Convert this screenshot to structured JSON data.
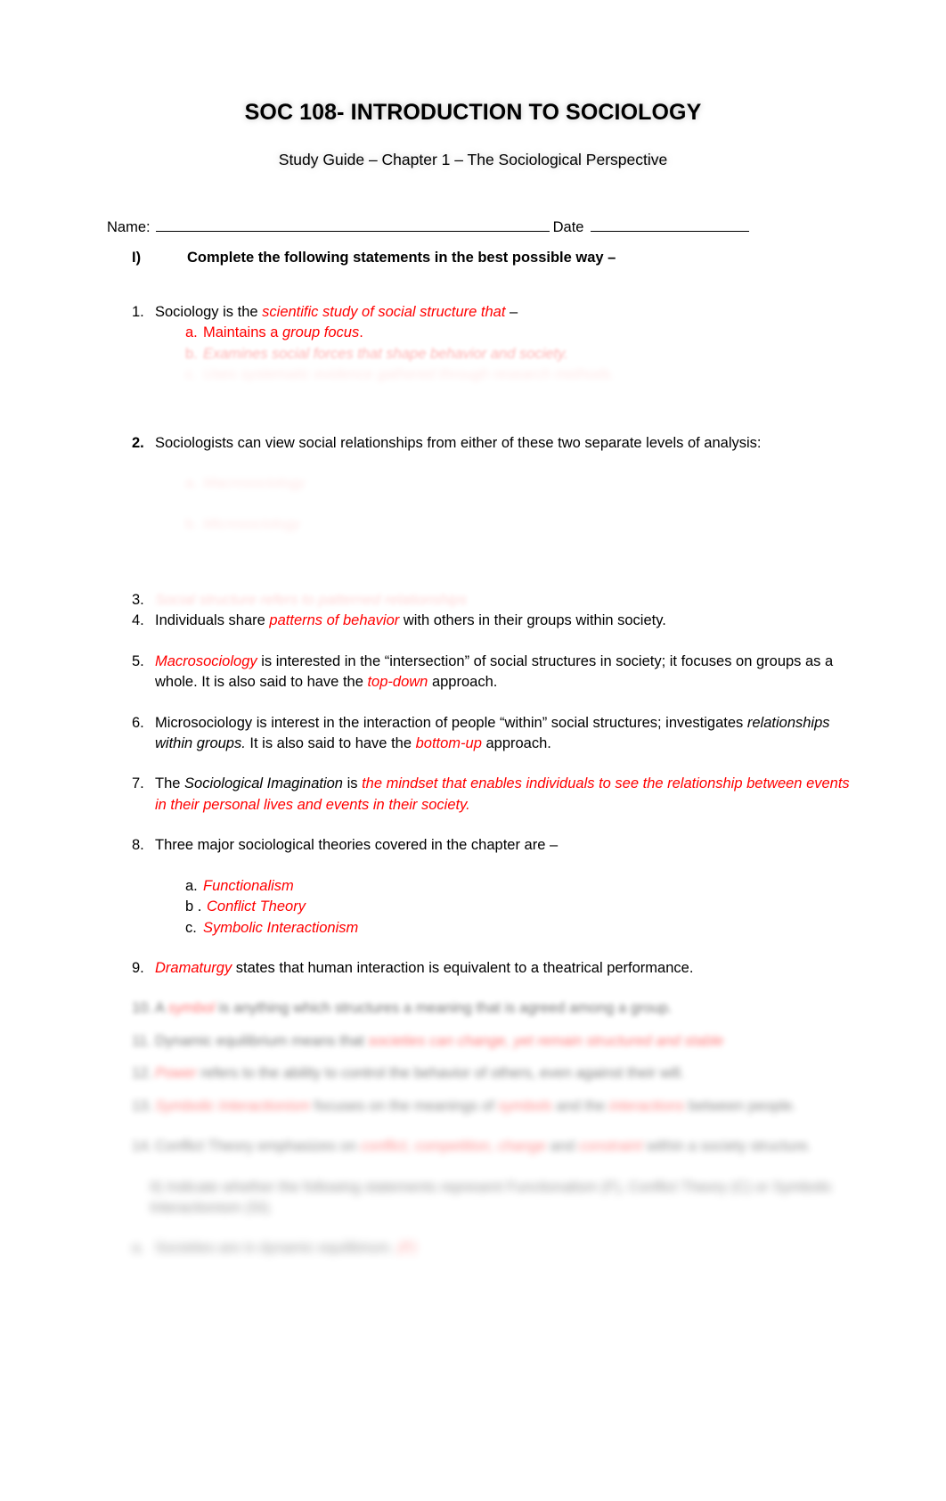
{
  "document": {
    "title": "SOC 108- INTRODUCTION TO SOCIOLOGY",
    "subtitle": "Study Guide – Chapter 1 – The Sociological Perspective"
  },
  "name_date": {
    "name_label": "Name:",
    "date_label": "Date"
  },
  "section": {
    "numeral": "I)",
    "heading": "Complete the following statements in the best possible way –"
  },
  "items": {
    "q1": {
      "num": "1.",
      "lead": "Sociology  is  the ",
      "answer": "scientific study of social structure that",
      "trail": " –",
      "sub_a": {
        "letter": "a.",
        "lead": "Maintains  a ",
        "answer": "group focus",
        "trail": "."
      },
      "sub_b_faded": {
        "letter": "b.",
        "text": "Examines social forces that shape behavior and society."
      },
      "sub_c_faded": {
        "letter": "c.",
        "text": "Uses systematic evidence gathered through research methods."
      }
    },
    "q2": {
      "num": "2.",
      "text": "Sociologists can view social relationships from either of these two separate levels of analysis:",
      "sub_a_faded": {
        "letter": "a.",
        "text": "Macrosociology"
      },
      "sub_b_faded": {
        "letter": "b.",
        "text": "Microsociology"
      }
    },
    "q3": {
      "num": "3.",
      "answer_faded": "Social structure refers to patterned relationships"
    },
    "q4": {
      "num": "4.",
      "lead": "Individuals  share ",
      "answer": "patterns of behavior",
      "trail": " with others in their groups within society."
    },
    "q5": {
      "num": "5.",
      "answer1": "Macrosociology",
      "mid1": " is interested in the “intersection” of social structures in society; it focuses on groups as a whole. It is also said to have the ",
      "answer2": "top-down",
      "trail": " approach."
    },
    "q6": {
      "num": "6.",
      "lead": "Microsociology  is interest in the interaction of people “within” social structures; investigates ",
      "italic_black": "relationships within groups.",
      "mid": "  It is also said to have the ",
      "answer": "bottom-up",
      "trail": " approach."
    },
    "q7": {
      "num": "7.",
      "lead": "The ",
      "term": "Sociological Imagination",
      "mid": " is ",
      "answer": "the mindset that enables individuals to see the relationship between events in their personal lives and events in their society."
    },
    "q8": {
      "num": "8.",
      "text": "Three major sociological theories covered in the chapter are  –",
      "sub_a": {
        "letter": "a.",
        "answer": "Functionalism"
      },
      "sub_b": {
        "letter": "b .",
        "answer": "Conflict Theory"
      },
      "sub_c": {
        "letter": "c.",
        "answer": "Symbolic Interactionism"
      }
    },
    "q9": {
      "num": "9.",
      "answer": "Dramaturgy",
      "trail": " states that human interaction is equivalent to a theatrical performance."
    },
    "q10_blurred": {
      "num": "10.",
      "lead": "A ",
      "answer": "symbol",
      "trail": " is anything which structures a meaning that is agreed  among a group."
    },
    "q11_blurred": {
      "num": "11.",
      "lead": "Dynamic equilibrium means that ",
      "answer": "societies can change, yet remain structured and stable"
    },
    "q12_blurred": {
      "num": "12.",
      "answer": "Power",
      "trail": " refers to the ability to control the behavior of others, even against their will."
    },
    "q13_blurred": {
      "num": "13.",
      "answer1": "Symbolic Interactionism",
      "mid1": " focuses on the meanings of ",
      "answer2": "symbols",
      "mid2": " and the ",
      "answer3": "interactions",
      "trail": " between people."
    },
    "q14_blurred": {
      "num": "14.",
      "lead": "Conflict Theory emphasizes on ",
      "answer1": "conflict, competition, change",
      "mid": " and ",
      "answer2": "constraint",
      "trail": " within a society structure."
    },
    "instruction_blurred": {
      "text": "II) Indicate whether the following statements represent Functionalism (F), Conflict Theory (C) or Symbolic Interactionism (SI)."
    },
    "q15_blurred": {
      "num": "a.",
      "lead": "Societies are in dynamic equilibrium. ",
      "answer": "(F)"
    }
  }
}
